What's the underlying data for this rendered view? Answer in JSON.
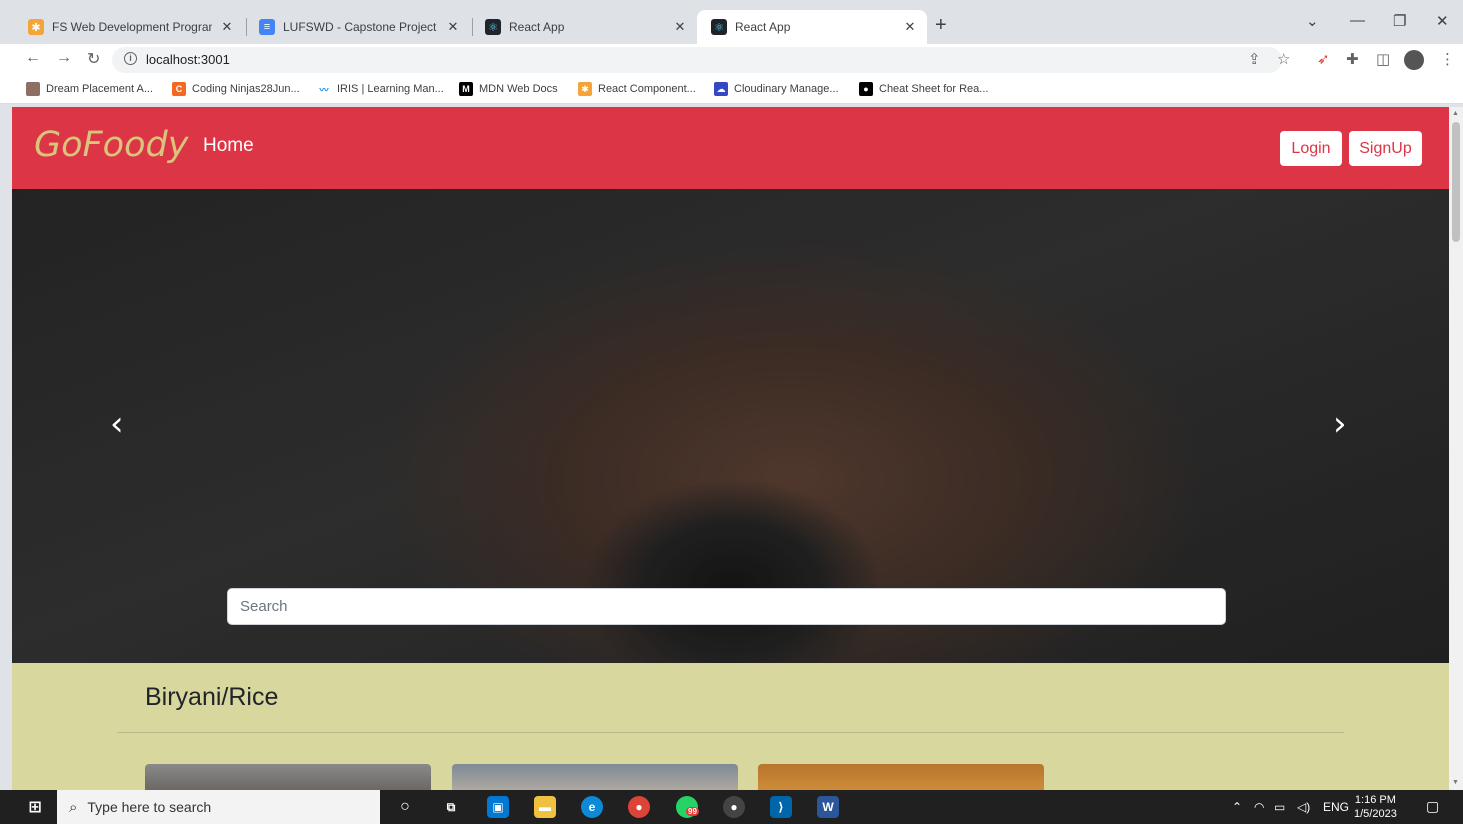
{
  "browser": {
    "tabs": [
      {
        "title": "FS Web Development Program M",
        "active": false
      },
      {
        "title": "LUFSWD - Capstone Project - Go",
        "active": false
      },
      {
        "title": "React App",
        "active": false
      },
      {
        "title": "React App",
        "active": true
      }
    ],
    "url": "localhost:3001",
    "bookmarks": [
      "Dream Placement A...",
      "Coding Ninjas28Jun...",
      "IRIS | Learning Man...",
      "MDN Web Docs",
      "React Component...",
      "Cloudinary Manage...",
      "Cheat Sheet for Rea..."
    ]
  },
  "navbar": {
    "brand": "GoFoody",
    "home": "Home",
    "login": "Login",
    "signup": "SignUp"
  },
  "carousel": {
    "search_placeholder": "Search",
    "prev": "‹",
    "next": "›"
  },
  "category": {
    "title": "Biryani/Rice"
  },
  "taskbar": {
    "search_placeholder": "Type here to search",
    "lang": "ENG",
    "time": "1:16 PM",
    "date": "1/5/2023",
    "whatsapp_badge": "99"
  },
  "colors": {
    "navbar": "#dc3545",
    "brand": "#d9c47c",
    "page_bg": "#d7d79e"
  }
}
